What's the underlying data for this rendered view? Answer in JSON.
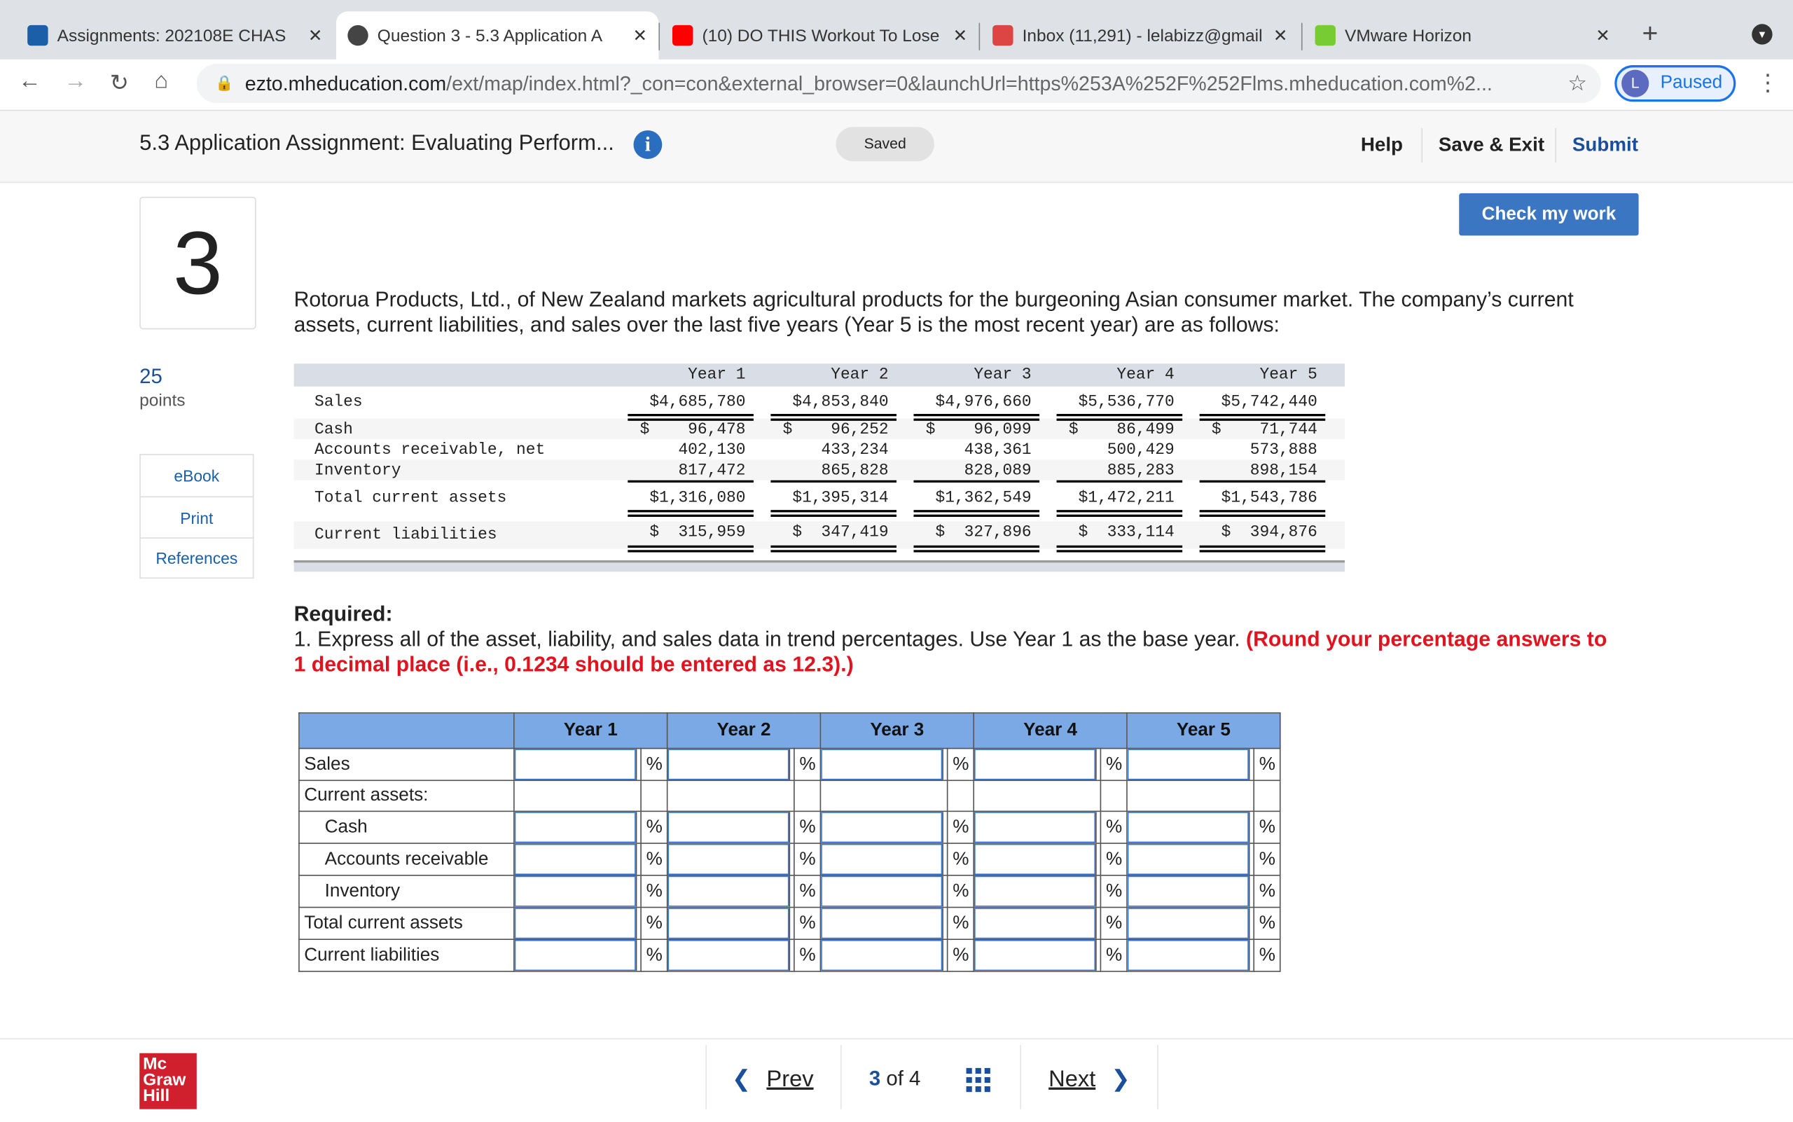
{
  "browser": {
    "tabs": [
      {
        "title": "Assignments: 202108E CHAS",
        "icon": "shield-icon"
      },
      {
        "title": "Question 3 - 5.3 Application A",
        "icon": "globe-icon"
      },
      {
        "title": "(10) DO THIS Workout To Lose",
        "icon": "youtube-icon"
      },
      {
        "title": "Inbox (11,291) - lelabizz@gmail",
        "icon": "gmail-icon"
      },
      {
        "title": "VMware Horizon",
        "icon": "vmware-icon"
      }
    ],
    "url_host": "ezto.mheducation.com",
    "url_path": "/ext/map/index.html?_con=con&external_browser=0&launchUrl=https%253A%252F%252Flms.mheducation.com%2...",
    "profile_initial": "L",
    "profile_status": "Paused",
    "colors": {
      "accent": "#1a73e8"
    }
  },
  "header": {
    "title": "5.3 Application Assignment: Evaluating Perform...",
    "saved": "Saved",
    "help": "Help",
    "save_exit": "Save & Exit",
    "submit": "Submit"
  },
  "question": {
    "number": "3",
    "points": "25",
    "points_label": "points",
    "check": "Check my work",
    "side_links": [
      "eBook",
      "Print",
      "References"
    ],
    "prompt": "Rotorua Products, Ltd., of New Zealand markets agricultural products for the burgeoning Asian consumer market. The company’s current assets, current liabilities, and sales over the last five years (Year 5 is the most recent year) are as follows:",
    "data_table": {
      "years": [
        "Year 1",
        "Year 2",
        "Year 3",
        "Year 4",
        "Year 5"
      ],
      "rows": [
        {
          "label": "Sales",
          "values": [
            "$4,685,780",
            "$4,853,840",
            "$4,976,660",
            "$5,536,770",
            "$5,742,440"
          ]
        },
        {
          "label": "Cash",
          "values": [
            "$    96,478",
            "$    96,252",
            "$    96,099",
            "$    86,499",
            "$    71,744"
          ]
        },
        {
          "label": "Accounts receivable, net",
          "values": [
            "402,130",
            "433,234",
            "438,361",
            "500,429",
            "573,888"
          ]
        },
        {
          "label": "Inventory",
          "values": [
            "817,472",
            "865,828",
            "828,089",
            "885,283",
            "898,154"
          ]
        },
        {
          "label": "Total current assets",
          "values": [
            "$1,316,080",
            "$1,395,314",
            "$1,362,549",
            "$1,472,211",
            "$1,543,786"
          ]
        },
        {
          "label": "Current liabilities",
          "values": [
            "$  315,959",
            "$  347,419",
            "$  327,896",
            "$  333,114",
            "$  394,876"
          ]
        }
      ]
    },
    "required_label": "Required:",
    "required_text": "1. Express all of the asset, liability, and sales data in trend percentages. Use Year 1 as the base year. ",
    "required_note": "(Round your percentage answers to 1 decimal place (i.e., 0.1234 should be entered as 12.3).)",
    "answer_table": {
      "years": [
        "Year 1",
        "Year 2",
        "Year 3",
        "Year 4",
        "Year 5"
      ],
      "unit": "%",
      "rows": [
        {
          "label": "Sales",
          "inputs": true,
          "indent": false
        },
        {
          "label": "Current assets:",
          "inputs": false,
          "indent": false
        },
        {
          "label": "Cash",
          "inputs": true,
          "indent": true
        },
        {
          "label": "Accounts receivable",
          "inputs": true,
          "indent": true
        },
        {
          "label": "Inventory",
          "inputs": true,
          "indent": true
        },
        {
          "label": "Total current assets",
          "inputs": true,
          "indent": false
        },
        {
          "label": "Current liabilities",
          "inputs": true,
          "indent": false
        }
      ]
    }
  },
  "footer": {
    "logo": "Mc Graw Hill",
    "prev": "Prev",
    "current": "3",
    "of": "of",
    "total": "4",
    "next": "Next"
  }
}
